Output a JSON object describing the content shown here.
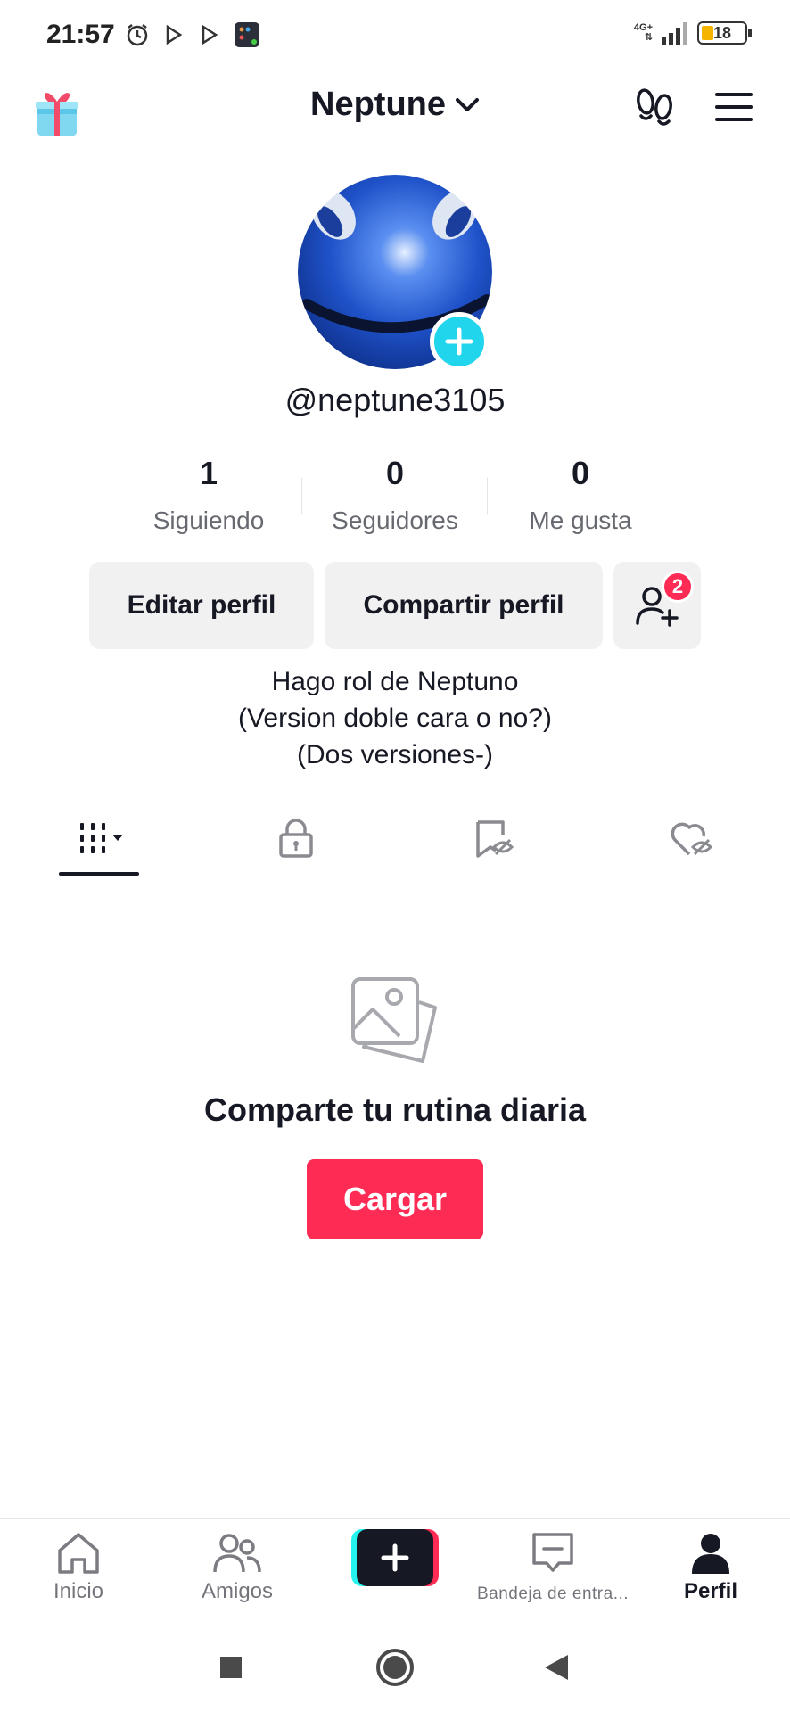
{
  "status_bar": {
    "time": "21:57",
    "network": "4G+",
    "battery": "18"
  },
  "header": {
    "title": "Neptune"
  },
  "profile": {
    "username": "@neptune3105",
    "stats": [
      {
        "value": "1",
        "label": "Siguiendo"
      },
      {
        "value": "0",
        "label": "Seguidores"
      },
      {
        "value": "0",
        "label": "Me gusta"
      }
    ],
    "buttons": {
      "edit": "Editar perfil",
      "share": "Compartir perfil",
      "friend_requests_badge": "2"
    },
    "bio": [
      "Hago rol de Neptuno",
      "(Version doble cara o no?)",
      "(Dos versiones-)"
    ]
  },
  "tabs": [
    {
      "name": "videos",
      "icon": "grid-icon",
      "active": true
    },
    {
      "name": "private",
      "icon": "lock-icon"
    },
    {
      "name": "favorites",
      "icon": "bookmark-icon"
    },
    {
      "name": "liked",
      "icon": "heart-icon"
    }
  ],
  "empty_state": {
    "title": "Comparte tu rutina diaria",
    "button": "Cargar"
  },
  "bottom_nav": {
    "items": [
      {
        "label": "Inicio",
        "icon": "home-icon"
      },
      {
        "label": "Amigos",
        "icon": "friends-icon"
      },
      {
        "label": "",
        "icon": "plus-icon"
      },
      {
        "label": "Bandeja de entra...",
        "icon": "inbox-icon"
      },
      {
        "label": "Perfil",
        "icon": "profile-icon",
        "active": true
      }
    ]
  },
  "colors": {
    "brand_red": "#fe2c55",
    "brand_cyan": "#20d5ec",
    "text_primary": "#161823"
  }
}
